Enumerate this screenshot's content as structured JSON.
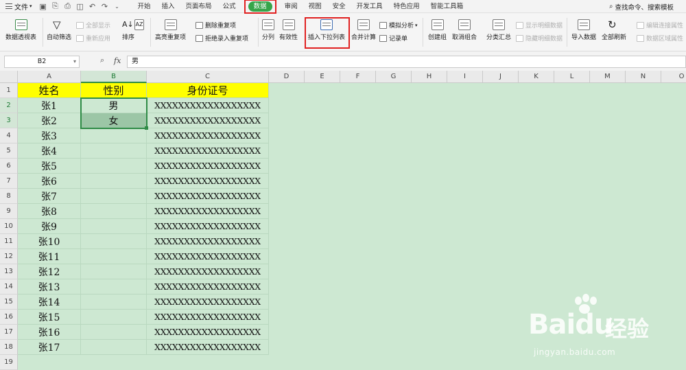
{
  "menubar": {
    "file_label": "文件",
    "tabs": [
      "开始",
      "插入",
      "页面布局",
      "公式",
      "数据",
      "审阅",
      "视图",
      "安全",
      "开发工具",
      "特色应用",
      "智能工具箱"
    ],
    "active_tab": "数据",
    "search_label": "查找命令、搜索模板"
  },
  "ribbon": {
    "pivot": "数据透视表",
    "autofilter": "自动筛选",
    "show_all": "全部显示",
    "reapply": "重新应用",
    "sort": "排序",
    "highlight_dup": "高亮重复项",
    "delete_dup": "删除重复项",
    "reject_dup": "拒绝录入重复项",
    "split": "分列",
    "validity": "有效性",
    "insert_dropdown": "插入下拉列表",
    "merge_calc": "合并计算",
    "sim_analysis": "模拟分析",
    "record_form": "记录单",
    "create_group": "创建组",
    "ungroup": "取消组合",
    "subtotal": "分类汇总",
    "show_detail": "显示明细数据",
    "hide_detail": "隐藏明细数据",
    "import_data": "导入数据",
    "refresh_all": "全部刷新",
    "edit_links": "编辑连接属性",
    "data_area_attr": "数据区域属性"
  },
  "formula_bar": {
    "name_box": "B2",
    "fx": "fx",
    "value": "男"
  },
  "columns": [
    "A",
    "B",
    "C",
    "D",
    "E",
    "F",
    "G",
    "H",
    "I",
    "J",
    "K",
    "L",
    "M",
    "N",
    "O"
  ],
  "rows": [
    "1",
    "2",
    "3",
    "4",
    "5",
    "6",
    "7",
    "8",
    "9",
    "10",
    "11",
    "12",
    "13",
    "14",
    "15",
    "16",
    "17",
    "18",
    "19"
  ],
  "sheet": {
    "headers": [
      "姓名",
      "性别",
      "身份证号"
    ],
    "names": [
      "张1",
      "张2",
      "张3",
      "张4",
      "张5",
      "张6",
      "张7",
      "张8",
      "张9",
      "张10",
      "张11",
      "张12",
      "张13",
      "张14",
      "张15",
      "张16",
      "张17"
    ],
    "genders": [
      "男",
      "女"
    ],
    "id_value": "XXXXXXXXXXXXXXXXXX"
  },
  "watermark": {
    "logo": "Bai",
    "logo_tail": "du",
    "cn": "经验",
    "url": "jingyan.baidu.com"
  },
  "colors": {
    "accent_green": "#36a54a",
    "highlight_red": "#e02020",
    "header_yellow": "#ffff00",
    "grid_bg": "#cde8d2"
  }
}
